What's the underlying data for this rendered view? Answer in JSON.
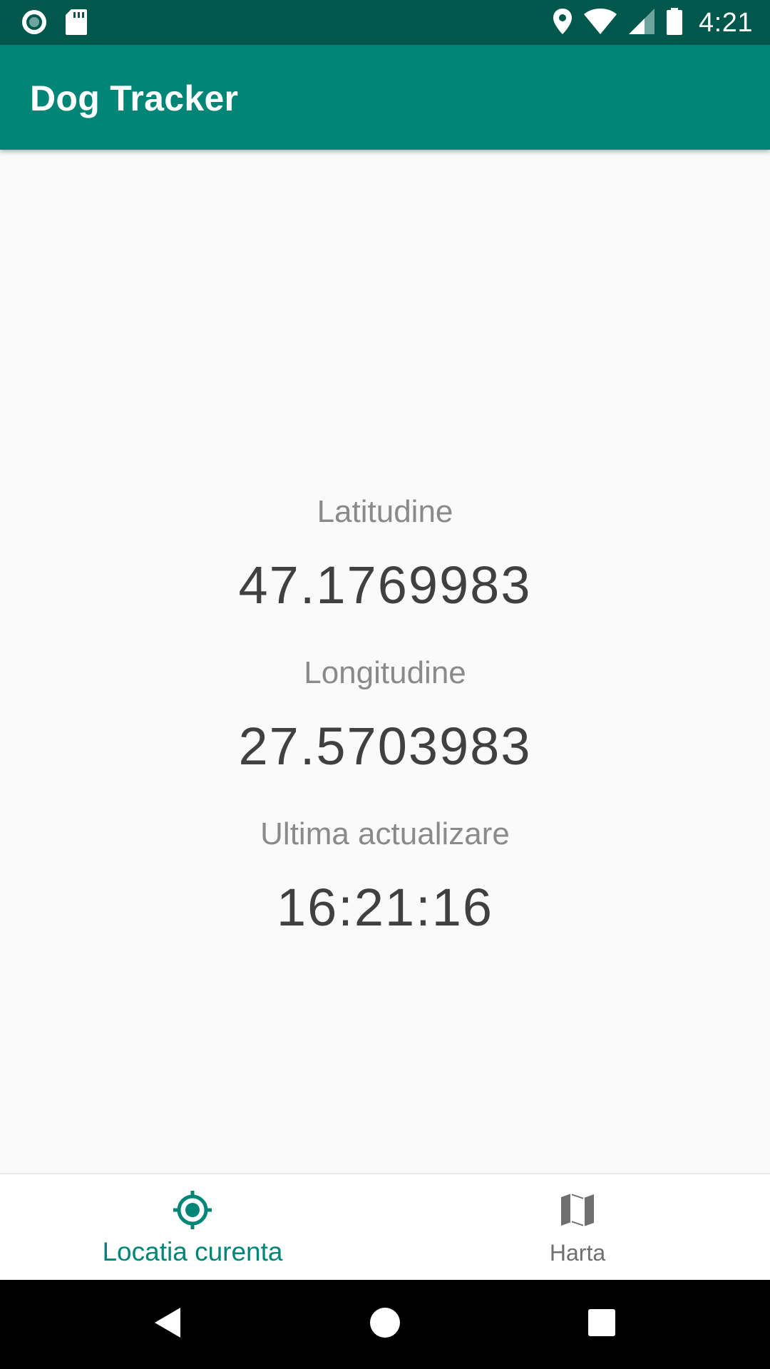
{
  "status_bar": {
    "time": "4:21",
    "icons": [
      "record-icon",
      "sd-card-icon",
      "location-pin-icon",
      "wifi-icon",
      "cell-signal-icon",
      "battery-icon"
    ]
  },
  "app_bar": {
    "title": "Dog Tracker"
  },
  "location": {
    "latitude_label": "Latitudine",
    "latitude_value": "47.1769983",
    "longitude_label": "Longitudine",
    "longitude_value": "27.5703983",
    "updated_label": "Ultima actualizare",
    "updated_value": "16:21:16"
  },
  "bottom_nav": {
    "items": [
      {
        "label": "Locatia curenta",
        "icon": "gps-target-icon",
        "active": true
      },
      {
        "label": "Harta",
        "icon": "map-icon",
        "active": false
      }
    ]
  },
  "colors": {
    "status_bar": "#00574b",
    "primary": "#008577",
    "label_text": "#8a8a8a",
    "value_text": "#404040",
    "inactive_nav": "#6f6f6f"
  }
}
